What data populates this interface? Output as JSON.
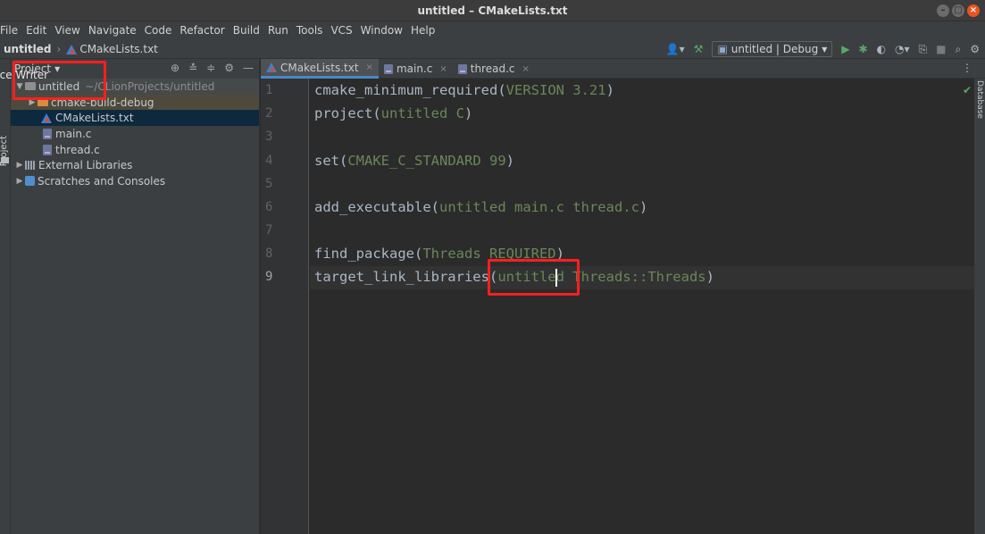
{
  "window": {
    "title": "untitled – CMakeLists.txt",
    "controls": [
      "–",
      "□",
      "×"
    ]
  },
  "menu": [
    "File",
    "Edit",
    "View",
    "Navigate",
    "Code",
    "Refactor",
    "Build",
    "Run",
    "Tools",
    "VCS",
    "Window",
    "Help"
  ],
  "navbar": {
    "root": "untitled",
    "file": "CMakeLists.txt",
    "run_config": "untitled | Debug"
  },
  "left_stripe": {
    "label": "Project"
  },
  "overlay_text": "ffice Writer",
  "project_panel": {
    "title": "Project",
    "tree": {
      "root_name": "untitled",
      "root_path": "~/CLionProjects/untitled",
      "build_dir": "cmake-build-debug",
      "cmake_file": "CMakeLists.txt",
      "main_file": "main.c",
      "thread_file": "thread.c",
      "external_libraries": "External Libraries",
      "scratches": "Scratches and Consoles"
    }
  },
  "tabs": [
    {
      "label": "CMakeLists.txt",
      "active": true
    },
    {
      "label": "main.c",
      "active": false
    },
    {
      "label": "thread.c",
      "active": false
    }
  ],
  "right_stripe": {
    "label": "Database"
  },
  "editor": {
    "line_numbers": [
      "1",
      "2",
      "3",
      "4",
      "5",
      "6",
      "7",
      "8",
      "9"
    ],
    "current_line": 9,
    "lines": [
      {
        "fn": "cmake_minimum_required",
        "open": "(",
        "arg": "VERSION 3.21",
        "close": ")"
      },
      {
        "fn": "project",
        "open": "(",
        "arg": "untitled C",
        "close": ")"
      },
      {
        "fn": "",
        "open": "",
        "arg": "",
        "close": ""
      },
      {
        "fn": "set",
        "open": "(",
        "arg": "CMAKE_C_STANDARD 99",
        "close": ")"
      },
      {
        "fn": "",
        "open": "",
        "arg": "",
        "close": ""
      },
      {
        "fn": "add_executable",
        "open": "(",
        "arg": "untitled main.c thread.c",
        "close": ")"
      },
      {
        "fn": "",
        "open": "",
        "arg": "",
        "close": ""
      },
      {
        "fn": "find_package",
        "open": "(",
        "arg": "Threads REQUIRED",
        "close": ")"
      },
      {
        "fn": "target_link_libraries",
        "open": "(",
        "arg": "untitled Threads::Threads",
        "close": ")"
      }
    ]
  },
  "colors": {
    "editor_bg": "#2b2b2b",
    "panel_bg": "#3c3f41",
    "selection": "#0d293e",
    "code_fn": "#a9b7c6",
    "code_arg": "#6a8759",
    "highlight_box": "#ff1f1f",
    "tab_accent": "#4a88c7"
  }
}
